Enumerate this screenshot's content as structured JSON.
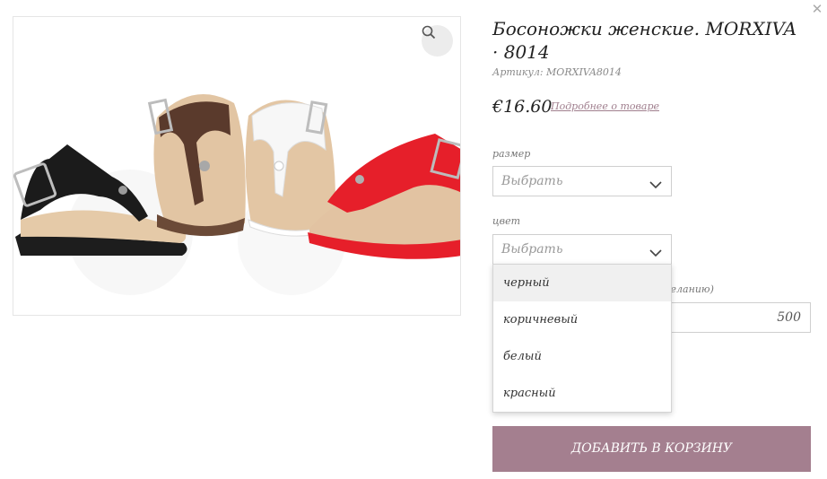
{
  "product": {
    "title": "Босоножки женские. MORXIVA · 8014",
    "sku": "Артикул: MORXIVA8014",
    "price": "€16.60",
    "more_link": "Подробнее о товаре"
  },
  "options": {
    "size": {
      "label": "размер",
      "placeholder": "Выбрать"
    },
    "color": {
      "label": "цвет",
      "placeholder": "Выбрать",
      "items": [
        "черный",
        "коричневый",
        "белый",
        "красный"
      ],
      "highlighted": "черный"
    }
  },
  "quantity": {
    "label_partial": "желанию)",
    "value": "500"
  },
  "add_to_cart": "ДОБАВИТЬ В КОРЗИНУ",
  "colors": {
    "accent": "#a47f8f",
    "link": "#a07f8e",
    "black_shoe": "#1b1b1b",
    "brown_shoe": "#5a3a2c",
    "white_shoe": "#f5f5f5",
    "red_shoe": "#e61f2a",
    "cork": "#e3c7a6"
  },
  "icons": {
    "close": "close-icon",
    "zoom": "zoom-icon",
    "chevron": "chevron-down-icon"
  }
}
